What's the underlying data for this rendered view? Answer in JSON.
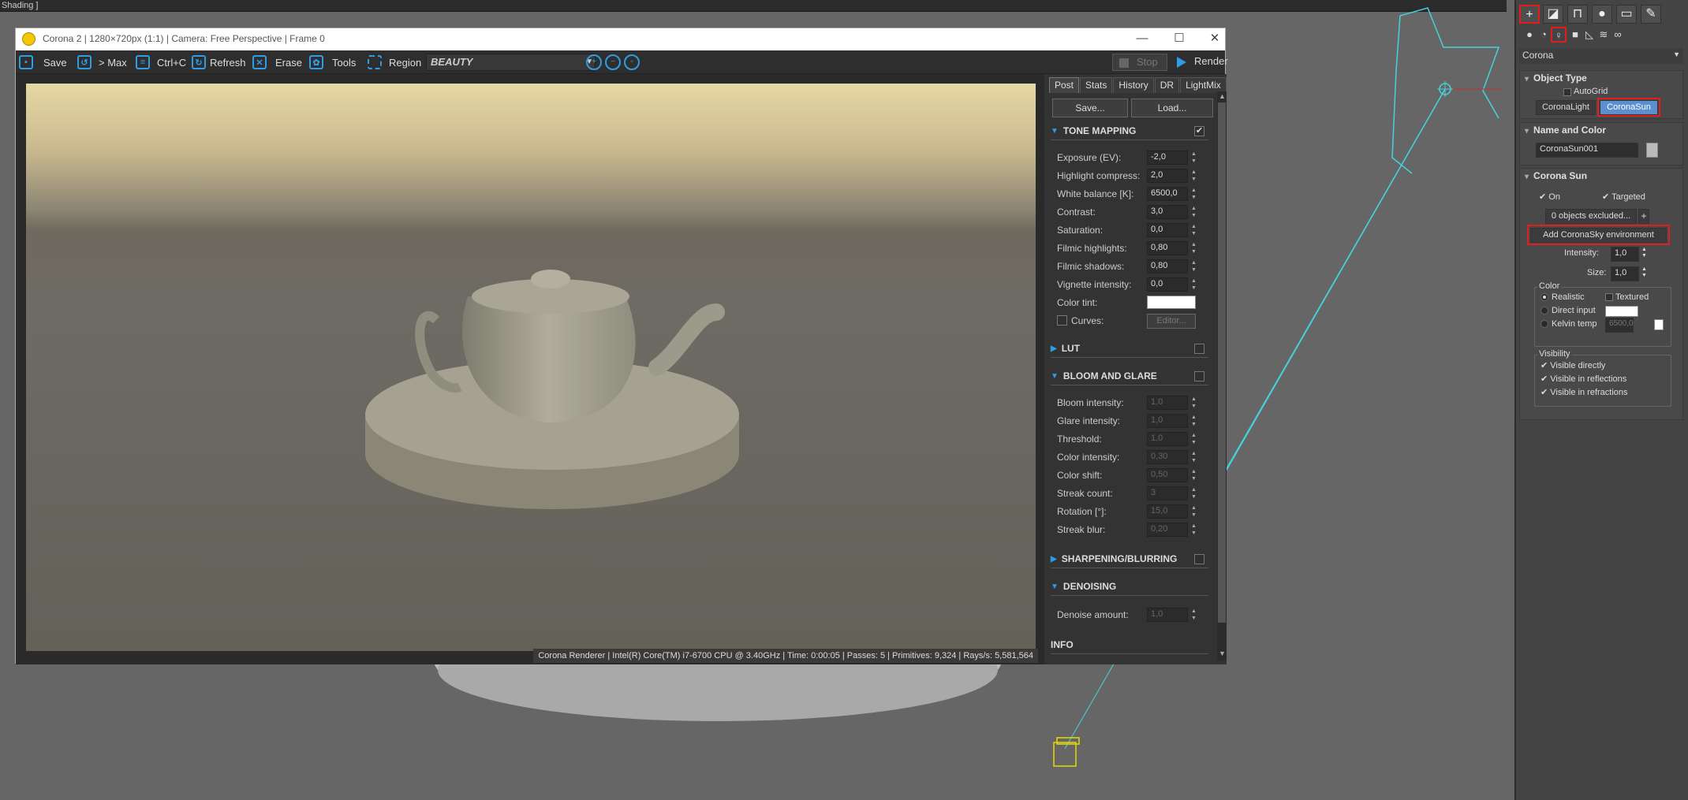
{
  "viewport": {
    "label": "Shading ]"
  },
  "window": {
    "title": "Corona 2 | 1280×720px (1:1) | Camera: Free Perspective | Frame 0",
    "controls": {
      "minimize": "—",
      "maximize": "☐",
      "close": "✕"
    }
  },
  "toolbar": {
    "save": "Save",
    "to_max": "> Max",
    "copy": "Ctrl+C",
    "refresh": "Refresh",
    "erase": "Erase",
    "tools": "Tools",
    "region": "Region",
    "pass_select": "BEAUTY",
    "stop": "Stop",
    "render": "Render"
  },
  "status": "Corona Renderer | Intel(R) Core(TM) i7-6700 CPU @ 3.40GHz | Time: 0:00:05 | Passes: 5 | Primitives: 9,324 | Rays/s: 5,581,564",
  "panel": {
    "tabs": [
      "Post",
      "Stats",
      "History",
      "DR",
      "LightMix"
    ],
    "save_btn": "Save...",
    "load_btn": "Load...",
    "tone_mapping": {
      "title": "TONE MAPPING",
      "rows": [
        {
          "label": "Exposure (EV):",
          "value": "-2,0"
        },
        {
          "label": "Highlight compress:",
          "value": "2,0"
        },
        {
          "label": "White balance [K]:",
          "value": "6500,0"
        },
        {
          "label": "Contrast:",
          "value": "3,0"
        },
        {
          "label": "Saturation:",
          "value": "0,0"
        },
        {
          "label": "Filmic highlights:",
          "value": "0,80"
        },
        {
          "label": "Filmic shadows:",
          "value": "0,80"
        },
        {
          "label": "Vignette intensity:",
          "value": "0,0"
        }
      ],
      "color_tint": "Color tint:",
      "curves": "Curves:",
      "editor": "Editor..."
    },
    "lut": {
      "title": "LUT"
    },
    "bloom": {
      "title": "BLOOM AND GLARE",
      "rows": [
        {
          "label": "Bloom intensity:",
          "value": "1,0"
        },
        {
          "label": "Glare intensity:",
          "value": "1,0"
        },
        {
          "label": "Threshold:",
          "value": "1,0"
        },
        {
          "label": "Color intensity:",
          "value": "0,30"
        },
        {
          "label": "Color shift:",
          "value": "0,50"
        },
        {
          "label": "Streak count:",
          "value": "3"
        },
        {
          "label": "Rotation [°]:",
          "value": "15,0"
        },
        {
          "label": "Streak blur:",
          "value": "0,20"
        }
      ]
    },
    "sharpening": {
      "title": "SHARPENING/BLURRING"
    },
    "denoising": {
      "title": "DENOISING",
      "label": "Denoise amount:",
      "value": "1,0"
    },
    "info": {
      "title": "INFO"
    }
  },
  "cmd": {
    "renderer": "Corona",
    "object_type": {
      "title": "Object Type",
      "autogrid": "AutoGrid",
      "corona_light": "CoronaLight",
      "corona_sun": "CoronaSun"
    },
    "name_color": {
      "title": "Name and Color",
      "name": "CoronaSun001"
    },
    "corona_sun": {
      "title": "Corona Sun",
      "on": "On",
      "targeted": "Targeted",
      "excluded": "0 objects excluded...",
      "plus": "+",
      "add_sky": "Add CoronaSky environment",
      "intensity_label": "Intensity:",
      "intensity": "1,0",
      "size_label": "Size:",
      "size": "1,0",
      "color_group": "Color",
      "realistic": "Realistic",
      "textured": "Textured",
      "direct": "Direct input",
      "kelvin": "Kelvin temp",
      "kelvin_value": "6500,0",
      "visibility_group": "Visibility",
      "vis_direct": "Visible directly",
      "vis_refl": "Visible in reflections",
      "vis_refr": "Visible in refractions"
    }
  },
  "colors": {
    "accent": "#2e9de5",
    "highlight": "#e01e1e",
    "wire": "#46d2dc",
    "target": "#e8d800"
  }
}
